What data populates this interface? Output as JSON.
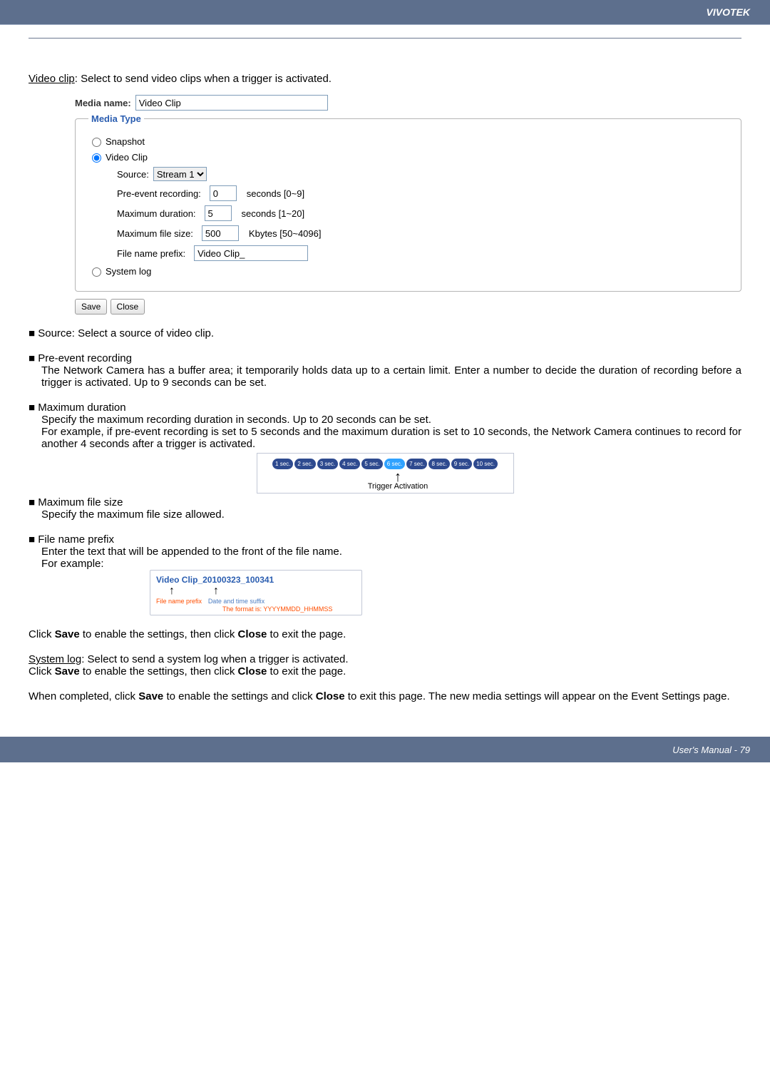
{
  "header": {
    "brand": "VIVOTEK"
  },
  "intro": {
    "video_clip_label": "Video clip",
    "video_clip_after": ": Select to send video clips when a trigger is activated."
  },
  "form": {
    "media_name_label": "Media name:",
    "media_name_value": "Video Clip",
    "legend": "Media Type",
    "snapshot_label": "Snapshot",
    "video_clip_label": "Video Clip",
    "source_label": "Source:",
    "source_value": "Stream 1",
    "pre_event_label": "Pre-event recording:",
    "pre_event_value": "0",
    "pre_event_suffix": "seconds [0~9]",
    "max_dur_label": "Maximum duration:",
    "max_dur_value": "5",
    "max_dur_suffix": "seconds [1~20]",
    "max_size_label": "Maximum file size:",
    "max_size_value": "500",
    "max_size_suffix": "Kbytes [50~4096]",
    "prefix_label": "File name prefix:",
    "prefix_value": "Video Clip_",
    "system_log_label": "System log",
    "save_label": "Save",
    "close_label": "Close"
  },
  "body": {
    "source_bullet": "Source: Select a source of video clip.",
    "pre_head": "Pre-event recording",
    "pre_p1": "The Network Camera has a buffer area; it temporarily holds data up to a certain limit. Enter a number to decide the duration of recording before a trigger is activated. Up to 9 seconds can be set.",
    "maxdur_head": "Maximum duration",
    "maxdur_p1": "Specify the maximum recording duration in seconds. Up to 20 seconds can be set.",
    "maxdur_p2": "For example, if pre-event recording is set to 5 seconds and the maximum duration is set to 10 seconds, the Network Camera continues to record for another 4 seconds after a trigger is activated.",
    "timeline_caption": "Trigger Activation",
    "pills": [
      "1 sec.",
      "2 sec.",
      "3 sec.",
      "4 sec.",
      "5 sec.",
      "6 sec.",
      "7 sec.",
      "8 sec.",
      "9 sec.",
      "10 sec."
    ],
    "maxsize_head": "Maximum file size",
    "maxsize_p1": "Specify the maximum file size allowed.",
    "fnprefix_head": "File name prefix",
    "fnprefix_p1": "Enter the text that will be appended to the front of the file name.",
    "fnprefix_for_example": "For example:",
    "fn_example": "Video Clip_20100323_100341",
    "fn_prefix_lbl": "File name prefix",
    "fn_suffix_lbl": "Date and time suffix",
    "fn_format": "The format is: YYYYMMDD_HHMMSS",
    "save_close_1a": "Click ",
    "save_bold": "Save",
    "save_close_1b": " to enable the settings, then click ",
    "close_bold": "Close",
    "save_close_1c": " to exit the page.",
    "syslog_label": "System log",
    "syslog_after": ": Select to send a system log when a trigger is activated.",
    "final_a": "When completed, click ",
    "final_b": " to enable the settings and click ",
    "final_c": " to exit this page. The new media settings will appear on the Event Settings page."
  },
  "footer": {
    "text": "User's Manual - 79"
  }
}
